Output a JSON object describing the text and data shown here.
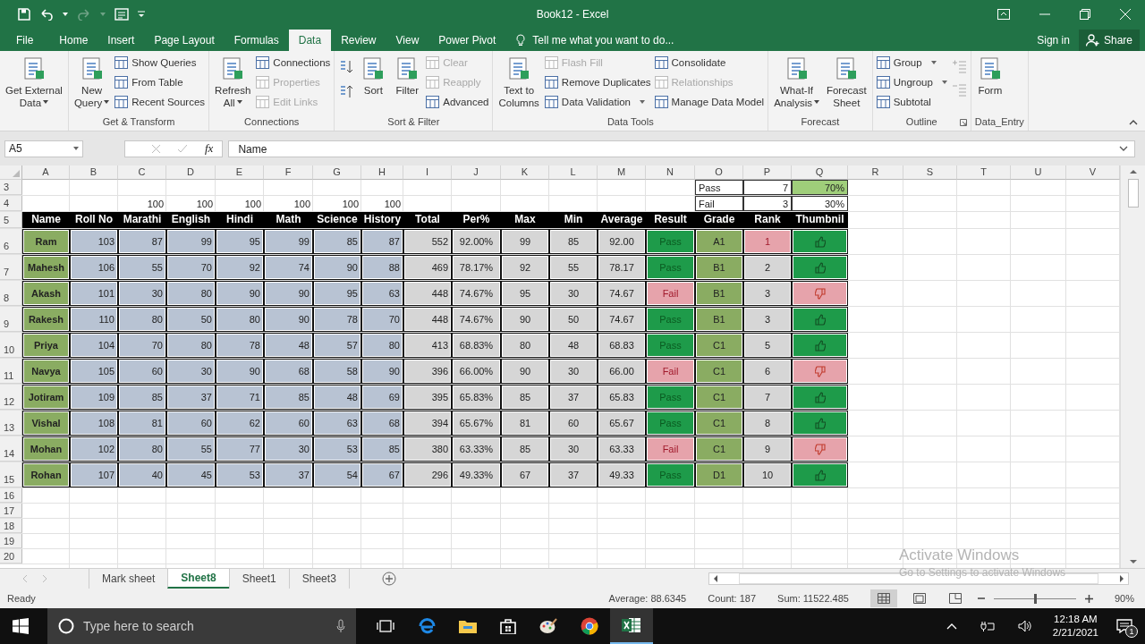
{
  "window": {
    "title": "Book12 - Excel"
  },
  "ribbon_tabs": [
    {
      "label": "File",
      "selected": false
    },
    {
      "label": "Home",
      "selected": false
    },
    {
      "label": "Insert",
      "selected": false
    },
    {
      "label": "Page Layout",
      "selected": false
    },
    {
      "label": "Formulas",
      "selected": false
    },
    {
      "label": "Data",
      "selected": true
    },
    {
      "label": "Review",
      "selected": false
    },
    {
      "label": "View",
      "selected": false
    },
    {
      "label": "Power Pivot",
      "selected": false
    }
  ],
  "tell_me": {
    "placeholder": "Tell me what you want to do..."
  },
  "account": {
    "sign_in": "Sign in",
    "share": "Share"
  },
  "ribbon_groups": [
    {
      "columns": [
        {
          "kind": "large",
          "lines": [
            "Get External",
            "Data"
          ],
          "dropdown": true,
          "disabled": false
        }
      ]
    },
    {
      "label": "Get & Transform",
      "columns": [
        {
          "kind": "large",
          "lines": [
            "New",
            "Query"
          ],
          "dropdown": true,
          "disabled": false
        },
        {
          "kind": "stack",
          "items": [
            {
              "label": "Show Queries",
              "disabled": false,
              "dropdown": false
            },
            {
              "label": "From Table",
              "disabled": false,
              "dropdown": false
            },
            {
              "label": "Recent Sources",
              "disabled": false,
              "dropdown": false
            }
          ]
        }
      ]
    },
    {
      "label": "Connections",
      "columns": [
        {
          "kind": "large",
          "lines": [
            "Refresh",
            "All"
          ],
          "dropdown": true,
          "disabled": false
        },
        {
          "kind": "stack",
          "items": [
            {
              "label": "Connections",
              "disabled": false,
              "dropdown": false
            },
            {
              "label": "Properties",
              "disabled": true,
              "dropdown": false
            },
            {
              "label": "Edit Links",
              "disabled": true,
              "dropdown": false
            }
          ]
        }
      ]
    },
    {
      "label": "Sort & Filter",
      "columns": [
        {
          "kind": "sort_icons"
        },
        {
          "kind": "large",
          "lines": [
            "Sort"
          ],
          "dropdown": false,
          "disabled": false
        },
        {
          "kind": "large",
          "lines": [
            "Filter"
          ],
          "dropdown": false,
          "disabled": false
        },
        {
          "kind": "stack",
          "items": [
            {
              "label": "Clear",
              "disabled": true,
              "dropdown": false
            },
            {
              "label": "Reapply",
              "disabled": true,
              "dropdown": false
            },
            {
              "label": "Advanced",
              "disabled": false,
              "dropdown": false
            }
          ]
        }
      ]
    },
    {
      "label": "Data Tools",
      "columns": [
        {
          "kind": "large",
          "lines": [
            "Text to",
            "Columns"
          ],
          "dropdown": false,
          "disabled": false
        },
        {
          "kind": "stack",
          "items": [
            {
              "label": "Flash Fill",
              "disabled": true,
              "dropdown": false
            },
            {
              "label": "Remove Duplicates",
              "disabled": false,
              "dropdown": false
            },
            {
              "label": "Data Validation",
              "disabled": false,
              "dropdown": true
            }
          ]
        },
        {
          "kind": "stack",
          "items": [
            {
              "label": "Consolidate",
              "disabled": false,
              "dropdown": false
            },
            {
              "label": "Relationships",
              "disabled": true,
              "dropdown": false
            },
            {
              "label": "Manage Data Model",
              "disabled": false,
              "dropdown": false
            }
          ]
        }
      ]
    },
    {
      "label": "Forecast",
      "columns": [
        {
          "kind": "large",
          "lines": [
            "What-If",
            "Analysis"
          ],
          "dropdown": true,
          "disabled": false
        },
        {
          "kind": "large",
          "lines": [
            "Forecast",
            "Sheet"
          ],
          "dropdown": false,
          "disabled": false
        }
      ]
    },
    {
      "label": "Outline",
      "launcher": true,
      "columns": [
        {
          "kind": "stack",
          "items": [
            {
              "label": "Group",
              "disabled": false,
              "dropdown": true
            },
            {
              "label": "Ungroup",
              "disabled": false,
              "dropdown": true
            },
            {
              "label": "Subtotal",
              "disabled": false,
              "dropdown": false
            }
          ]
        },
        {
          "kind": "detail_icons"
        }
      ]
    },
    {
      "label": "Data_Entry",
      "columns": [
        {
          "kind": "large",
          "lines": [
            "Form"
          ],
          "dropdown": false,
          "disabled": false
        }
      ]
    }
  ],
  "formula_bar": {
    "name_box": "A5",
    "function_label": "fx",
    "value": "Name"
  },
  "sheet": {
    "columns": [
      "A",
      "B",
      "C",
      "D",
      "E",
      "F",
      "G",
      "H",
      "I",
      "J",
      "K",
      "L",
      "M",
      "N",
      "O",
      "P",
      "Q",
      "R",
      "S",
      "T",
      "U",
      "V"
    ],
    "summary_rows": [
      {
        "num": "3",
        "label": "Pass",
        "count": "7",
        "share": "70%",
        "highlight": true
      },
      {
        "num": "4",
        "max_marks": [
          "100",
          "100",
          "100",
          "100",
          "100",
          "100"
        ],
        "label": "Fail",
        "count": "3",
        "share": "30%",
        "highlight": false
      }
    ],
    "header": {
      "num": "5",
      "cells": [
        "Name",
        "Roll No",
        "Marathi",
        "English",
        "Hindi",
        "Math",
        "Science",
        "History",
        "Total",
        "Per%",
        "Max",
        "Min",
        "Average",
        "Result",
        "Grade",
        "Rank",
        "Thumbnil"
      ]
    },
    "students": [
      {
        "num": "6",
        "name": "Ram",
        "roll": "103",
        "marks": [
          "87",
          "99",
          "95",
          "99",
          "85",
          "87"
        ],
        "total": "552",
        "percent": "92.00%",
        "max": "99",
        "min": "85",
        "average": "92.00",
        "result": "Pass",
        "passed": true,
        "grade": "A1",
        "rank": "1",
        "top_rank": true
      },
      {
        "num": "7",
        "name": "Mahesh",
        "roll": "106",
        "marks": [
          "55",
          "70",
          "92",
          "74",
          "90",
          "88"
        ],
        "total": "469",
        "percent": "78.17%",
        "max": "92",
        "min": "55",
        "average": "78.17",
        "result": "Pass",
        "passed": true,
        "grade": "B1",
        "rank": "2",
        "top_rank": false
      },
      {
        "num": "8",
        "name": "Akash",
        "roll": "101",
        "marks": [
          "30",
          "80",
          "90",
          "90",
          "95",
          "63"
        ],
        "total": "448",
        "percent": "74.67%",
        "max": "95",
        "min": "30",
        "average": "74.67",
        "result": "Fail",
        "passed": false,
        "grade": "B1",
        "rank": "3",
        "top_rank": false
      },
      {
        "num": "9",
        "name": "Rakesh",
        "roll": "110",
        "marks": [
          "80",
          "50",
          "80",
          "90",
          "78",
          "70"
        ],
        "total": "448",
        "percent": "74.67%",
        "max": "90",
        "min": "50",
        "average": "74.67",
        "result": "Pass",
        "passed": true,
        "grade": "B1",
        "rank": "3",
        "top_rank": false
      },
      {
        "num": "10",
        "name": "Priya",
        "roll": "104",
        "marks": [
          "70",
          "80",
          "78",
          "48",
          "57",
          "80"
        ],
        "total": "413",
        "percent": "68.83%",
        "max": "80",
        "min": "48",
        "average": "68.83",
        "result": "Pass",
        "passed": true,
        "grade": "C1",
        "rank": "5",
        "top_rank": false
      },
      {
        "num": "11",
        "name": "Navya",
        "roll": "105",
        "marks": [
          "60",
          "30",
          "90",
          "68",
          "58",
          "90"
        ],
        "total": "396",
        "percent": "66.00%",
        "max": "90",
        "min": "30",
        "average": "66.00",
        "result": "Fail",
        "passed": false,
        "grade": "C1",
        "rank": "6",
        "top_rank": false
      },
      {
        "num": "12",
        "name": "Jotiram",
        "roll": "109",
        "marks": [
          "85",
          "37",
          "71",
          "85",
          "48",
          "69"
        ],
        "total": "395",
        "percent": "65.83%",
        "max": "85",
        "min": "37",
        "average": "65.83",
        "result": "Pass",
        "passed": true,
        "grade": "C1",
        "rank": "7",
        "top_rank": false
      },
      {
        "num": "13",
        "name": "Vishal",
        "roll": "108",
        "marks": [
          "81",
          "60",
          "62",
          "60",
          "63",
          "68"
        ],
        "total": "394",
        "percent": "65.67%",
        "max": "81",
        "min": "60",
        "average": "65.67",
        "result": "Pass",
        "passed": true,
        "grade": "C1",
        "rank": "8",
        "top_rank": false
      },
      {
        "num": "14",
        "name": "Mohan",
        "roll": "102",
        "marks": [
          "80",
          "55",
          "77",
          "30",
          "53",
          "85"
        ],
        "total": "380",
        "percent": "63.33%",
        "max": "85",
        "min": "30",
        "average": "63.33",
        "result": "Fail",
        "passed": false,
        "grade": "C1",
        "rank": "9",
        "top_rank": false
      },
      {
        "num": "15",
        "name": "Rohan",
        "roll": "107",
        "marks": [
          "40",
          "45",
          "53",
          "37",
          "54",
          "67"
        ],
        "total": "296",
        "percent": "49.33%",
        "max": "67",
        "min": "37",
        "average": "49.33",
        "result": "Pass",
        "passed": true,
        "grade": "D1",
        "rank": "10",
        "top_rank": false
      }
    ],
    "empty_rows": [
      "16",
      "17",
      "18",
      "19",
      "20"
    ]
  },
  "sheet_tabs": [
    {
      "label": "Mark sheet",
      "selected": false
    },
    {
      "label": "Sheet8",
      "selected": true
    },
    {
      "label": "Sheet1",
      "selected": false
    },
    {
      "label": "Sheet3",
      "selected": false
    }
  ],
  "activation_notice": {
    "title": "Activate Windows",
    "hint": "Go to Settings to activate Windows"
  },
  "status_bar": {
    "mode": "Ready",
    "average": "Average: 88.6345",
    "count": "Count: 187",
    "sum": "Sum: 11522.485",
    "view_modes": [
      {
        "selected": true
      },
      {
        "selected": false
      },
      {
        "selected": false
      }
    ],
    "zoom": {
      "level": 0.5
    },
    "zoom_label": "90%"
  },
  "taskbar": {
    "search": {
      "placeholder": "Type here to search"
    },
    "time": "12:18 AM",
    "date": "2/21/2021",
    "notification_count": "1"
  }
}
